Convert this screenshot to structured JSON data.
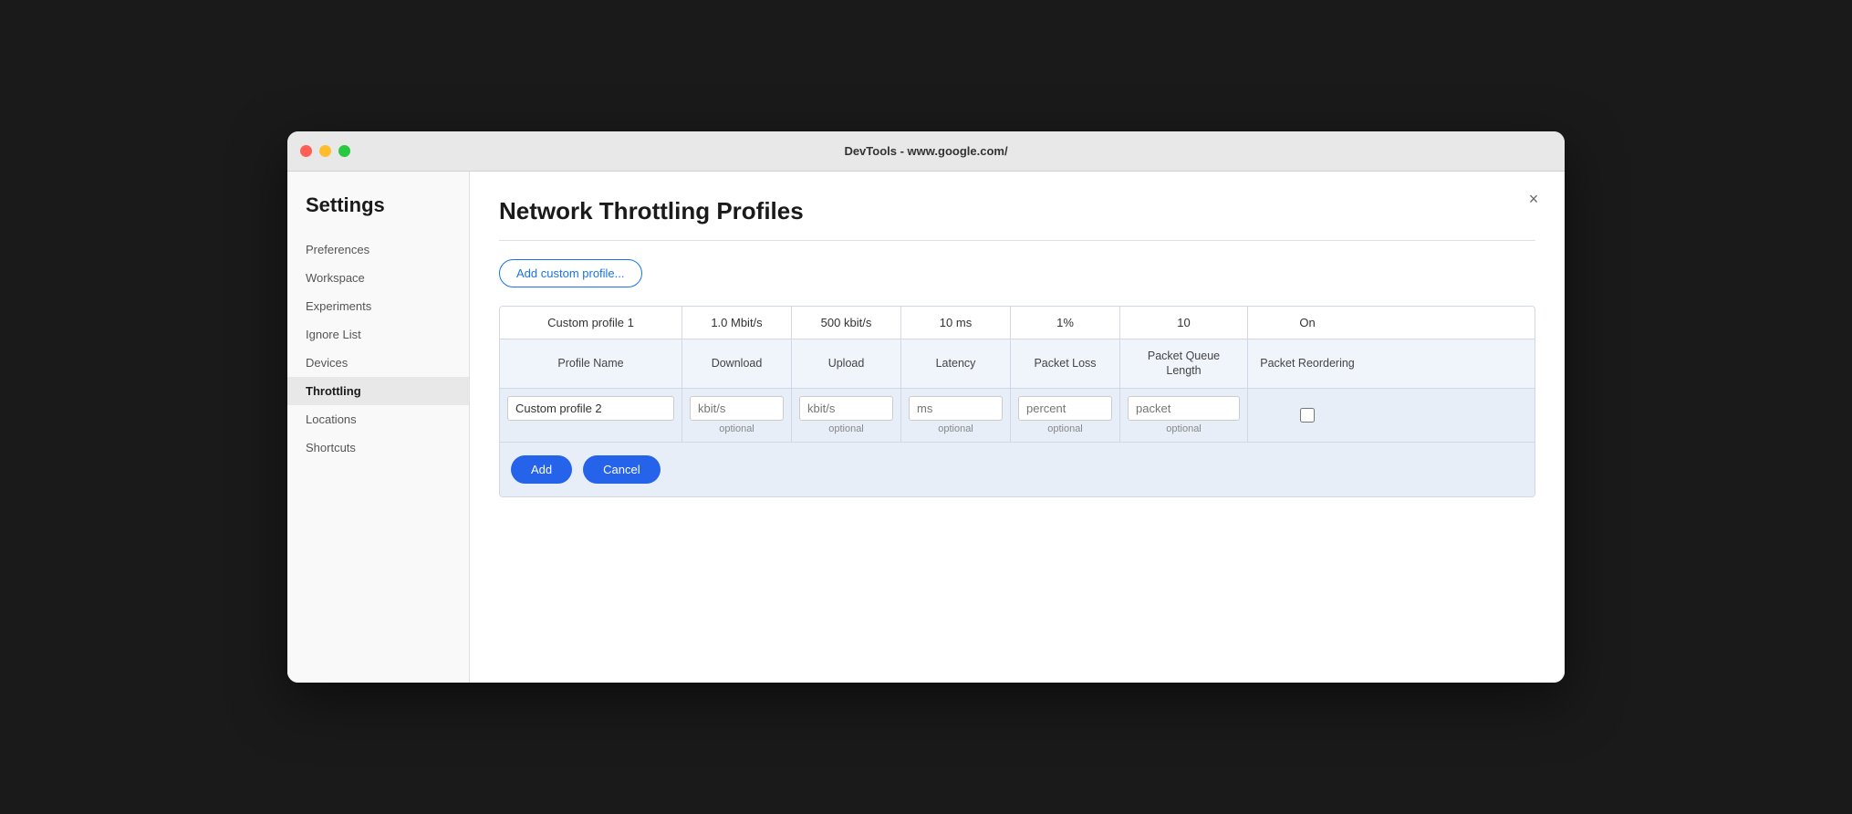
{
  "window": {
    "title": "DevTools - www.google.com/"
  },
  "sidebar": {
    "heading": "Settings",
    "items": [
      {
        "label": "Preferences",
        "active": false
      },
      {
        "label": "Workspace",
        "active": false
      },
      {
        "label": "Experiments",
        "active": false
      },
      {
        "label": "Ignore List",
        "active": false
      },
      {
        "label": "Devices",
        "active": false
      },
      {
        "label": "Throttling",
        "active": true
      },
      {
        "label": "Locations",
        "active": false
      },
      {
        "label": "Shortcuts",
        "active": false
      }
    ]
  },
  "main": {
    "title": "Network Throttling Profiles",
    "add_button_label": "Add custom profile...",
    "close_label": "×",
    "existing_profile": {
      "name": "Custom profile 1",
      "download": "1.0 Mbit/s",
      "upload": "500 kbit/s",
      "latency": "10 ms",
      "packet_loss": "1%",
      "packet_queue": "10",
      "packet_reordering": "On"
    },
    "table_headers": {
      "profile_name": "Profile Name",
      "download": "Download",
      "upload": "Upload",
      "latency": "Latency",
      "packet_loss": "Packet Loss",
      "packet_queue": "Packet Queue Length",
      "packet_reordering": "Packet Reordering"
    },
    "form": {
      "profile_name_value": "Custom profile 2",
      "download_placeholder": "kbit/s",
      "download_hint": "optional",
      "upload_placeholder": "kbit/s",
      "upload_hint": "optional",
      "latency_placeholder": "ms",
      "latency_hint": "optional",
      "packet_loss_placeholder": "percent",
      "packet_loss_hint": "optional",
      "packet_queue_placeholder": "packet",
      "packet_queue_hint": "optional"
    },
    "add_label": "Add",
    "cancel_label": "Cancel"
  }
}
